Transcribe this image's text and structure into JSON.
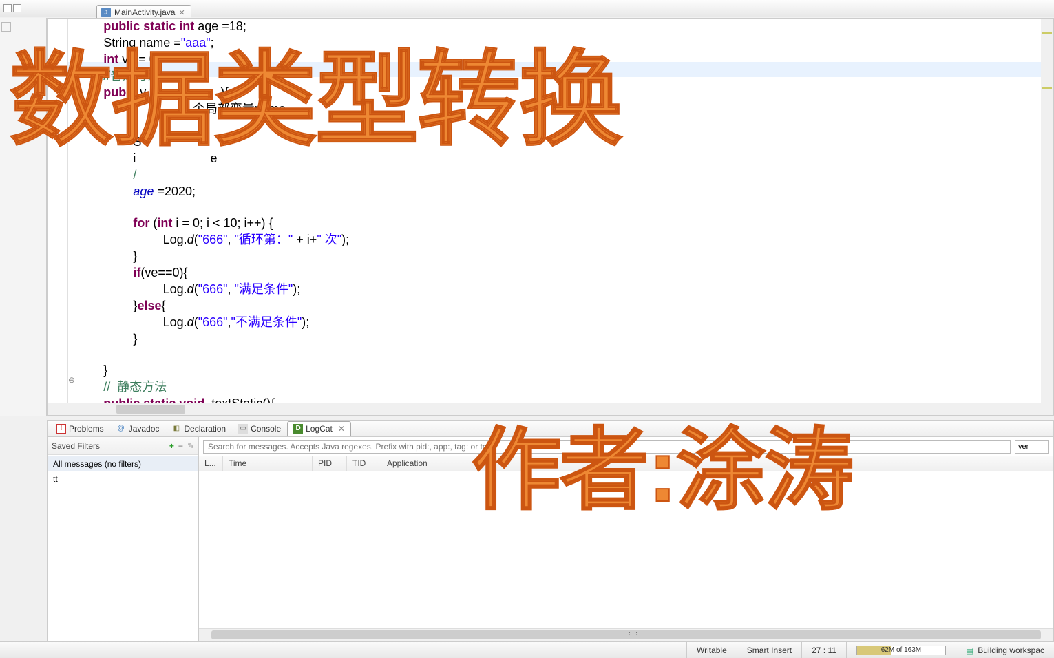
{
  "tab": {
    "filename": "MainActivity.java"
  },
  "code": {
    "l1a": "public static int",
    "l1b": " age ",
    "l1c": "=18;",
    "l2a": "String name =",
    "l2b": "\"aaa\"",
    "l2c": ";",
    "l3a": "int",
    "l3b": " ve = 0;",
    "l4": "//普通方法",
    "l5a": "publi",
    "l5b": "  v",
    "l5c": "){",
    "l6": "个局部变量name",
    "l7": "/",
    "l8": "S",
    "l9a": "i",
    "l9b": "e",
    "l10": "/",
    "l11a": "age",
    "l11b": " =2020;",
    "l12a": "for",
    "l12b": " (",
    "l12c": "int",
    "l12d": " i = 0; i < 10; i++) {",
    "l13a": "Log.",
    "l13b": "d",
    "l13c": "(",
    "l13d": "\"666\"",
    "l13e": ", ",
    "l13f": "\"循环第：\"",
    "l13g": " + i+",
    "l13h": "\" 次\"",
    "l13i": ");",
    "l14": "}",
    "l15a": "if",
    "l15b": "(ve==0){",
    "l16a": "Log.",
    "l16b": "d",
    "l16c": "(",
    "l16d": "\"666\"",
    "l16e": ", ",
    "l16f": "\"满足条件\"",
    "l16g": ");",
    "l17a": "}",
    "l17b": "else",
    "l17c": "{",
    "l18a": "Log.",
    "l18b": "d",
    "l18c": "(",
    "l18d": "\"666\"",
    "l18e": ",",
    "l18f": "\"不满足条件\"",
    "l18g": ");",
    "l19": "}",
    "l20": "}",
    "l21": "//  静态方法",
    "l22a": "public static void",
    "l22b": "  textStatic(){"
  },
  "views": {
    "problems": "Problems",
    "javadoc": "Javadoc",
    "declaration": "Declaration",
    "console": "Console",
    "logcat": "LogCat"
  },
  "filters": {
    "title": "Saved Filters",
    "all": "All messages (no filters)",
    "tt": "tt"
  },
  "search": {
    "placeholder": "Search for messages. Accepts Java regexes. Prefix with pid:, app:, tag: or text",
    "level": "ver"
  },
  "logcols": {
    "l": "L...",
    "time": "Time",
    "pid": "PID",
    "tid": "TID",
    "app": "Application"
  },
  "status": {
    "writable": "Writable",
    "insert": "Smart Insert",
    "pos": "27 : 11",
    "mem": "62M of 163M",
    "build": "Building workspac"
  },
  "overlay": {
    "title": "数据类型转换",
    "author": "作者:涂涛"
  }
}
